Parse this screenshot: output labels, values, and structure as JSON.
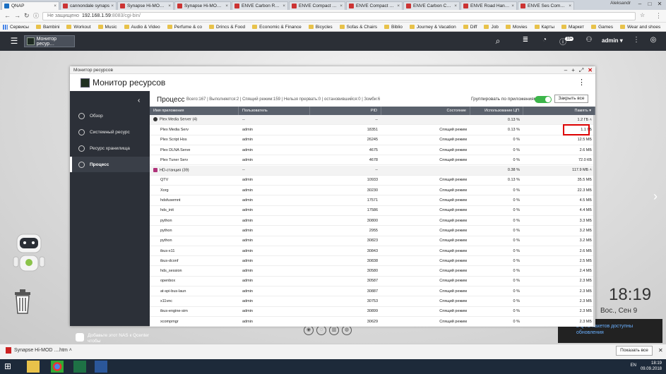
{
  "browser": {
    "tabs": [
      {
        "label": "QNAP"
      },
      {
        "label": "cannondale synaps"
      },
      {
        "label": "Synapse Hi-MOD D"
      },
      {
        "label": "Synapse Hi-MOD D"
      },
      {
        "label": "ENVE Carbon Road"
      },
      {
        "label": "ENVE Compact Roa"
      },
      {
        "label": "ENVE Compact Roa"
      },
      {
        "label": "ENVE Carbon Comp"
      },
      {
        "label": "ENVE Road Handle"
      },
      {
        "label": "ENVE Ses Compact"
      }
    ],
    "user": "Aleksandr",
    "url_warning": "Не защищено",
    "url_host": "192.168.1.59",
    "url_rest": ":8083/cgi-bin/",
    "bookmarks": [
      "Сервисы",
      "Bambini",
      "Workout",
      "Music",
      "Audio & Video",
      "Perfume & co",
      "Drincs & Food",
      "Economic & Finance",
      "Bicycles",
      "Sofas & Chairs",
      "Biblio",
      "Journey & Vacation",
      "Diff",
      "Job",
      "Movies",
      "Карты",
      "Маркет",
      "Games",
      "Wear and shoes"
    ],
    "other_bookmarks": "Другие закладки"
  },
  "qnap": {
    "app_tab": "Монитор ресур…",
    "badge": "10+",
    "user": "admin"
  },
  "desktop": {
    "time": "18:19",
    "date": "Вос., Сен 9",
    "notification": "в QTS пакетов доступны обновления"
  },
  "window": {
    "titlebar": "Монитор ресурсов",
    "title": "Монитор ресурсов",
    "sidebar": [
      {
        "label": "Обзор"
      },
      {
        "label": "Системный ресурс"
      },
      {
        "label": "Ресурс хранилища"
      },
      {
        "label": "Процесс"
      }
    ],
    "add_nas": "Добавьте этот NAS к Qcenter чтобы",
    "page_title": "Процесс",
    "stats": "Всего:167 | Выполняется:2 | Спящий режим:159 | Нельзя прервать:0 | остановившийся:0 | Зомби:6",
    "group_label": "Группировать по приложениям",
    "close_all": "Закрыть все",
    "columns": [
      "Имя приложения",
      "Пользователь",
      "PID",
      "Состояние",
      "Использование ЦП",
      "Память ▾"
    ],
    "rows": [
      {
        "grp": true,
        "icon": "plex",
        "name": "Plex Media Server (4)",
        "user": "--",
        "pid": "--",
        "state": "",
        "cpu": "0.13 %",
        "mem": "1.2 ГБ"
      },
      {
        "name": "Plex Media Serv",
        "user": "admin",
        "pid": "18351",
        "state": "Спящий режим",
        "cpu": "0.13 %",
        "mem": "1.1 ГБ"
      },
      {
        "name": "Plex Script Hos",
        "user": "admin",
        "pid": "26245",
        "state": "Спящий режим",
        "cpu": "0 %",
        "mem": "12.5 МБ"
      },
      {
        "name": "Plex DLNA Serve",
        "user": "admin",
        "pid": "4675",
        "state": "Спящий режим",
        "cpu": "0 %",
        "mem": "2.6 МБ"
      },
      {
        "name": "Plex Tuner Serv",
        "user": "admin",
        "pid": "4678",
        "state": "Спящий режим",
        "cpu": "0 %",
        "mem": "72.0 КБ"
      },
      {
        "grp": true,
        "icon": "hd",
        "name": "HD-станция (39)",
        "user": "--",
        "pid": "--",
        "state": "",
        "cpu": "0.38 %",
        "mem": "117.9 МБ"
      },
      {
        "name": "QTV",
        "user": "admin",
        "pid": "10933",
        "state": "Спящий режим",
        "cpu": "0.13 %",
        "mem": "35.5 МБ"
      },
      {
        "name": "Xorg",
        "user": "admin",
        "pid": "30230",
        "state": "Спящий режим",
        "cpu": "0 %",
        "mem": "22.3 МБ"
      },
      {
        "name": "hdsfusemnt",
        "user": "admin",
        "pid": "17571",
        "state": "Спящий режим",
        "cpu": "0 %",
        "mem": "4.5 МБ"
      },
      {
        "name": "hds_init",
        "user": "admin",
        "pid": "17586",
        "state": "Спящий режим",
        "cpu": "0 %",
        "mem": "4.4 МБ"
      },
      {
        "name": "python",
        "user": "admin",
        "pid": "30800",
        "state": "Спящий режим",
        "cpu": "0 %",
        "mem": "3.3 МБ"
      },
      {
        "name": "python",
        "user": "admin",
        "pid": "2955",
        "state": "Спящий режим",
        "cpu": "0 %",
        "mem": "3.2 МБ"
      },
      {
        "name": "python",
        "user": "admin",
        "pid": "30823",
        "state": "Спящий режим",
        "cpu": "0 %",
        "mem": "3.2 МБ"
      },
      {
        "name": "ibus-x11",
        "user": "admin",
        "pid": "30843",
        "state": "Спящий режим",
        "cpu": "0 %",
        "mem": "2.6 МБ"
      },
      {
        "name": "ibus-dconf",
        "user": "admin",
        "pid": "30838",
        "state": "Спящий режим",
        "cpu": "0 %",
        "mem": "2.5 МБ"
      },
      {
        "name": "hds_session",
        "user": "admin",
        "pid": "30580",
        "state": "Спящий режим",
        "cpu": "0 %",
        "mem": "2.4 МБ"
      },
      {
        "name": "openbox",
        "user": "admin",
        "pid": "30587",
        "state": "Спящий режим",
        "cpu": "0 %",
        "mem": "2.3 МБ"
      },
      {
        "name": "at-spi-bus-laun",
        "user": "admin",
        "pid": "30887",
        "state": "Спящий режим",
        "cpu": "0 %",
        "mem": "2.3 МБ"
      },
      {
        "name": "x11vnc",
        "user": "admin",
        "pid": "30753",
        "state": "Спящий режим",
        "cpu": "0 %",
        "mem": "2.3 МБ"
      },
      {
        "name": "ibus-engine-sim",
        "user": "admin",
        "pid": "30899",
        "state": "Спящий режим",
        "cpu": "0 %",
        "mem": "2.3 МБ"
      },
      {
        "name": "xcompmgr",
        "user": "admin",
        "pid": "30629",
        "state": "Спящий режим",
        "cpu": "0 %",
        "mem": "2.3 МБ"
      }
    ]
  },
  "downloads": {
    "file": "Synapse Hi-MOD ....htm",
    "show_all": "Показать все"
  },
  "taskbar": {
    "lang": "EN",
    "time": "18:19",
    "date": "09.09.2018"
  }
}
